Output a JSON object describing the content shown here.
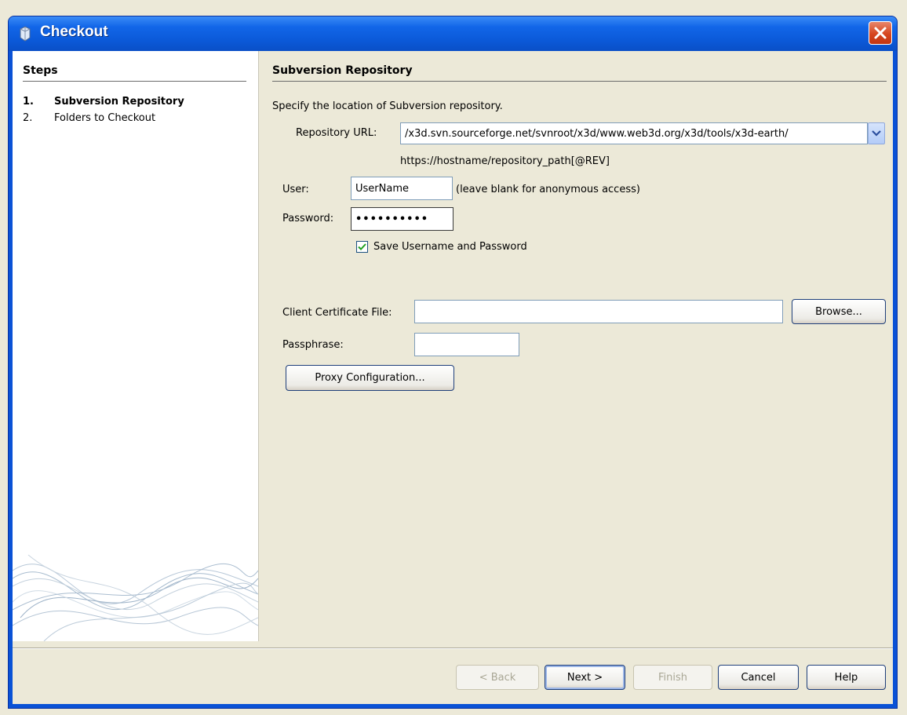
{
  "window": {
    "title": "Checkout"
  },
  "steps": {
    "heading": "Steps",
    "items": [
      {
        "num": "1.",
        "label": "Subversion Repository"
      },
      {
        "num": "2.",
        "label": "Folders to Checkout"
      }
    ]
  },
  "main": {
    "heading": "Subversion Repository",
    "description": "Specify the location of Subversion repository.",
    "repo_url_label": "Repository URL:",
    "repo_url_value": "/x3d.svn.sourceforge.net/svnroot/x3d/www.web3d.org/x3d/tools/x3d-earth/",
    "repo_url_hint": "https://hostname/repository_path[@REV]",
    "user_label": "User:",
    "user_value": "UserName",
    "user_hint": "(leave blank for anonymous access)",
    "password_label": "Password:",
    "password_value": "••••••••••",
    "save_label": "Save Username and Password",
    "save_checked": true,
    "cert_label": "Client Certificate File:",
    "cert_value": "",
    "browse_label": "Browse...",
    "passphrase_label": "Passphrase:",
    "passphrase_value": "",
    "proxy_label": "Proxy Configuration..."
  },
  "footer": {
    "back": "< Back",
    "next": "Next >",
    "finish": "Finish",
    "cancel": "Cancel",
    "help": "Help"
  }
}
